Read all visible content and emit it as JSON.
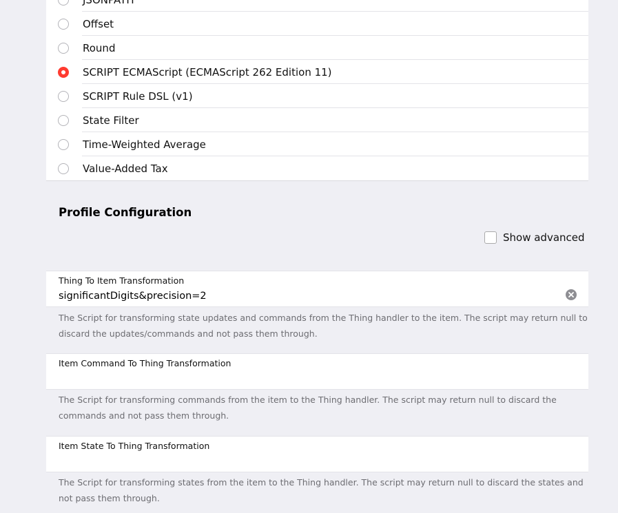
{
  "transformations": [
    {
      "label": "JSONPATH",
      "checked": false
    },
    {
      "label": "Offset",
      "checked": false
    },
    {
      "label": "Round",
      "checked": false
    },
    {
      "label": "SCRIPT ECMAScript (ECMAScript 262 Edition 11)",
      "checked": true
    },
    {
      "label": "SCRIPT Rule DSL (v1)",
      "checked": false
    },
    {
      "label": "State Filter",
      "checked": false
    },
    {
      "label": "Time-Weighted Average",
      "checked": false
    },
    {
      "label": "Value-Added Tax",
      "checked": false
    }
  ],
  "profile_config": {
    "title": "Profile Configuration",
    "show_advanced_label": "Show advanced",
    "show_advanced_checked": false
  },
  "fields": {
    "thing_to_item": {
      "label": "Thing To Item Transformation",
      "value": "significantDigits&precision=2",
      "help": "The Script for transforming state updates and commands from the Thing handler to the item. The script may return null to discard the updates/commands and not pass them through."
    },
    "item_command_to_thing": {
      "label": "Item Command To Thing Transformation",
      "value": "",
      "help": "The Script for transforming commands from the item to the Thing handler. The script may return null to discard the commands and not pass them through."
    },
    "item_state_to_thing": {
      "label": "Item State To Thing Transformation",
      "value": "",
      "help": "The Script for transforming states from the item to the Thing handler. The script may return null to discard the states and not pass them through."
    }
  },
  "icons": {
    "clear": "clear-circle-icon"
  },
  "colors": {
    "accent": "#ff3b30",
    "background": "#efeff4",
    "help_text": "#6d6d72"
  }
}
